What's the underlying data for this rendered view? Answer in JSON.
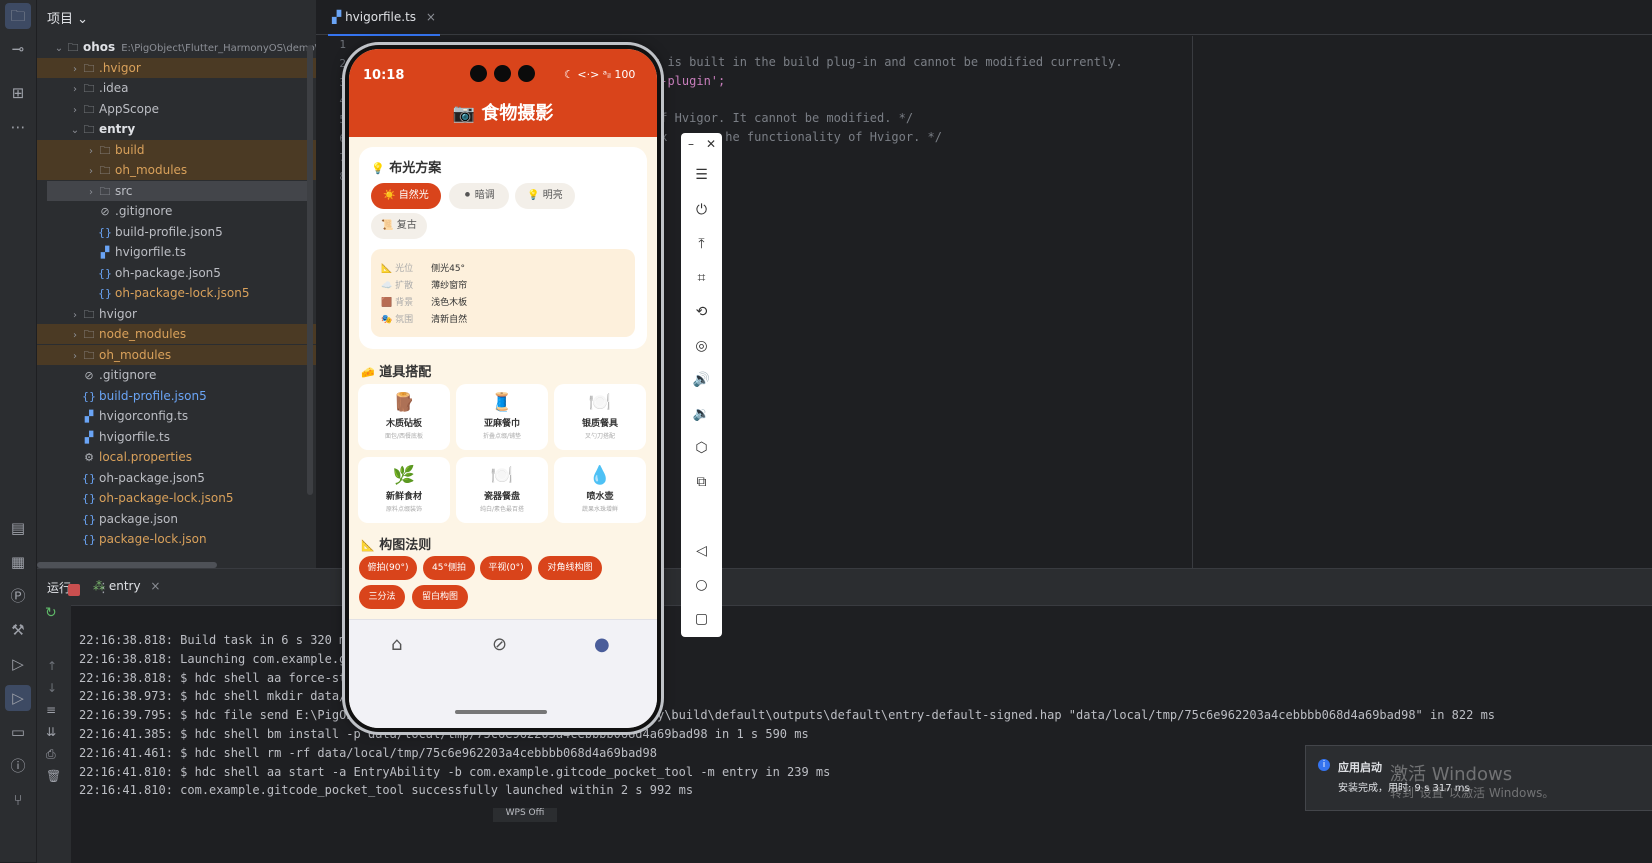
{
  "toolbar_left": {
    "icons": [
      "folder-icon",
      "commit-icon",
      "structure-icon",
      "more-icon",
      "todo-icon",
      "layers-icon",
      "profiler-icon",
      "build-icon",
      "services-icon",
      "run-icon",
      "terminal-icon",
      "problems-icon",
      "git-icon"
    ]
  },
  "project": {
    "header": "项目",
    "tree": [
      {
        "label": "ohos",
        "path": "E:\\PigObject\\Flutter_HarmonyOS\\demo\\g",
        "indent": 1,
        "arrow": "⌄",
        "kind": "root"
      },
      {
        "label": ".hvigor",
        "indent": 2,
        "arrow": "›",
        "kind": "folder",
        "color": "orange",
        "hl": true
      },
      {
        "label": ".idea",
        "indent": 2,
        "arrow": "›",
        "kind": "folder"
      },
      {
        "label": "AppScope",
        "indent": 2,
        "arrow": "›",
        "kind": "folder"
      },
      {
        "label": "entry",
        "indent": 2,
        "arrow": "⌄",
        "kind": "module"
      },
      {
        "label": "build",
        "indent": 3,
        "arrow": "›",
        "kind": "folder",
        "color": "orange",
        "hl": true
      },
      {
        "label": "oh_modules",
        "indent": 3,
        "arrow": "›",
        "kind": "folder",
        "color": "orange",
        "hl": true
      },
      {
        "label": "src",
        "indent": 3,
        "arrow": "›",
        "kind": "folder",
        "sel": true
      },
      {
        "label": ".gitignore",
        "indent": 3,
        "kind": "ignore"
      },
      {
        "label": "build-profile.json5",
        "indent": 3,
        "kind": "json"
      },
      {
        "label": "hvigorfile.ts",
        "indent": 3,
        "kind": "ts"
      },
      {
        "label": "oh-package.json5",
        "indent": 3,
        "kind": "json"
      },
      {
        "label": "oh-package-lock.json5",
        "indent": 3,
        "kind": "json",
        "color": "orange"
      },
      {
        "label": "hvigor",
        "indent": 2,
        "arrow": "›",
        "kind": "folder"
      },
      {
        "label": "node_modules",
        "indent": 2,
        "arrow": "›",
        "kind": "folder",
        "color": "orange",
        "hl": true
      },
      {
        "label": "oh_modules",
        "indent": 2,
        "arrow": "›",
        "kind": "folder",
        "color": "orange",
        "hl": true
      },
      {
        "label": ".gitignore",
        "indent": 2,
        "kind": "ignore"
      },
      {
        "label": "build-profile.json5",
        "indent": 2,
        "kind": "json",
        "color": "blue"
      },
      {
        "label": "hvigorconfig.ts",
        "indent": 2,
        "kind": "ts"
      },
      {
        "label": "hvigorfile.ts",
        "indent": 2,
        "kind": "ts"
      },
      {
        "label": "local.properties",
        "indent": 2,
        "kind": "gear",
        "color": "orange"
      },
      {
        "label": "oh-package.json5",
        "indent": 2,
        "kind": "json"
      },
      {
        "label": "oh-package-lock.json5",
        "indent": 2,
        "kind": "json",
        "color": "orange"
      },
      {
        "label": "package.json",
        "indent": 2,
        "kind": "json"
      },
      {
        "label": "package-lock.json",
        "indent": 2,
        "kind": "json",
        "color": "orange"
      }
    ]
  },
  "editor": {
    "tab": "hvigorfile.ts",
    "line_numbers": [
      "1",
      "2",
      "3",
      "4",
      "5",
      "6",
      "7",
      "8"
    ],
    "code": [
      "t is built in the build plug-in and cannot be modified currently.",
      "s-plugin';",
      "of Hvigor. It cannot be modified. */",
      "ex        he functionality of Hvigor. */"
    ]
  },
  "run": {
    "title": "运行",
    "tab": "entry",
    "logs": [
      "22:16:38.818: Build task in 6 s 320 ms",
      "22:16:38.818: Launching com.example.git",
      "22:16:38.818: $ hdc shell aa force-stop",
      "22:16:38.973: $ hdc shell mkdir data/lo",
      "22:16:39.795: $ hdc file send E:\\PigObje                            ol\\ohos\\entry\\build\\default\\outputs\\default\\entry-default-signed.hap \"data/local/tmp/75c6e962203a4cebbbb068d4a69bad98\" in 822 ms",
      "22:16:41.385: $ hdc shell bm install -p data/local/tmp/75c6e962203a4cebbbb068d4a69bad98 in 1 s 590 ms",
      "22:16:41.461: $ hdc shell rm -rf data/local/tmp/75c6e962203a4cebbbb068d4a69bad98",
      "22:16:41.810: $ hdc shell aa start -a EntryAbility -b com.example.gitcode_pocket_tool -m entry in 239 ms",
      "22:16:41.810: com.example.gitcode_pocket_tool successfully launched within 2 s 992 ms"
    ]
  },
  "phone": {
    "time": "10:18",
    "status": "☾ <·> ᵃᵢₗ 100",
    "title": "📷 食物摄影",
    "lighting": {
      "title": "布光方案",
      "chips": [
        {
          "label": "☀️ 自然光",
          "on": true
        },
        {
          "label": "⚫ 暗调",
          "on": false
        },
        {
          "label": "💡 明亮",
          "on": false
        },
        {
          "label": "📜 复古",
          "on": false
        }
      ],
      "info": [
        {
          "icon": "📐",
          "k": "光位",
          "v": "侧光45°"
        },
        {
          "icon": "☁️",
          "k": "扩散",
          "v": "薄纱窗帘"
        },
        {
          "icon": "🟫",
          "k": "背景",
          "v": "浅色木板"
        },
        {
          "icon": "🎭",
          "k": "氛围",
          "v": "清新自然"
        }
      ]
    },
    "props": {
      "title": "道具搭配",
      "items": [
        {
          "icon": "🪵",
          "name": "木质砧板",
          "desc": "面包/西餐底板"
        },
        {
          "icon": "🧵",
          "name": "亚麻餐巾",
          "desc": "折叠点缀/铺垫"
        },
        {
          "icon": "🍽️",
          "name": "银质餐具",
          "desc": "叉勺刀搭配"
        },
        {
          "icon": "🌿",
          "name": "新鲜食材",
          "desc": "原料点缀装饰"
        },
        {
          "icon": "🍽️",
          "name": "瓷器餐盘",
          "desc": "纯白/素色最百搭"
        },
        {
          "icon": "💧",
          "name": "喷水壶",
          "desc": "蔬果水珠增鲜"
        }
      ]
    },
    "composition": {
      "title": "构图法则",
      "rules": [
        "俯拍(90°)",
        "45°侧拍",
        "平视(0°)",
        "对角线构图",
        "三分法",
        "留白构图"
      ]
    },
    "nav": [
      "home-icon",
      "compass-icon",
      "profile-icon"
    ]
  },
  "notification": {
    "title": "应用启动",
    "body": "安装完成，用时: 9 s 317 ms",
    "watermark": "激活 Windows",
    "watermark_sub": "转到\"设置\"以激活 Windows。"
  },
  "bottom_tab": "WPS Offi"
}
